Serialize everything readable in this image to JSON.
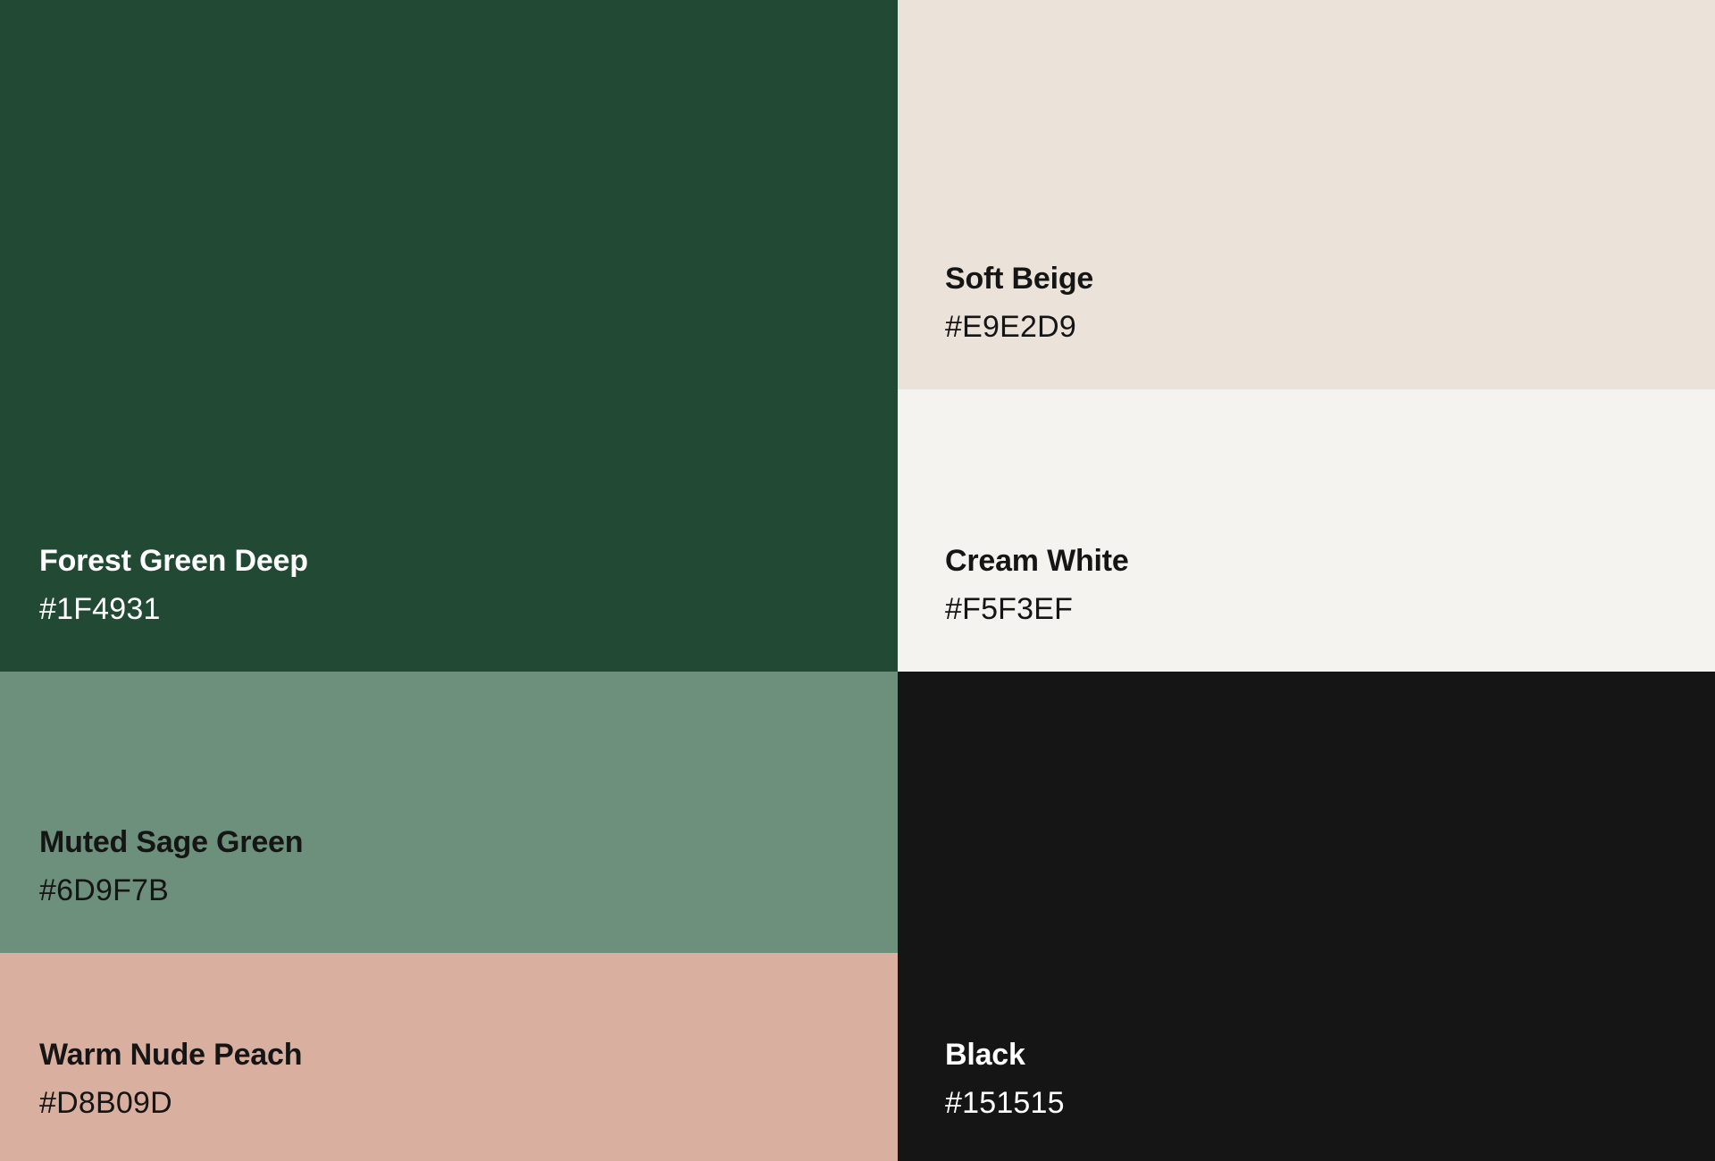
{
  "swatches": [
    {
      "id": "forest",
      "name": "Forest Green Deep",
      "hex": "#1F4931",
      "bg": "#214934",
      "text_color": "#FFFFFF"
    },
    {
      "id": "beige",
      "name": "Soft Beige",
      "hex": "#E9E2D9",
      "bg": "#EBE2D9",
      "text_color": "#151515"
    },
    {
      "id": "cream",
      "name": "Cream White",
      "hex": "#F5F3EF",
      "bg": "#F5F3EF",
      "text_color": "#151515"
    },
    {
      "id": "sage",
      "name": "Muted Sage Green",
      "hex": "#6D9F7B",
      "bg": "#6C907B",
      "text_color": "#151515"
    },
    {
      "id": "peach",
      "name": "Warm Nude Peach",
      "hex": "#D8B09D",
      "bg": "#D9B09F",
      "text_color": "#151515"
    },
    {
      "id": "black",
      "name": "Black",
      "hex": "#151515",
      "bg": "#151515",
      "text_color": "#FFFFFF"
    }
  ]
}
